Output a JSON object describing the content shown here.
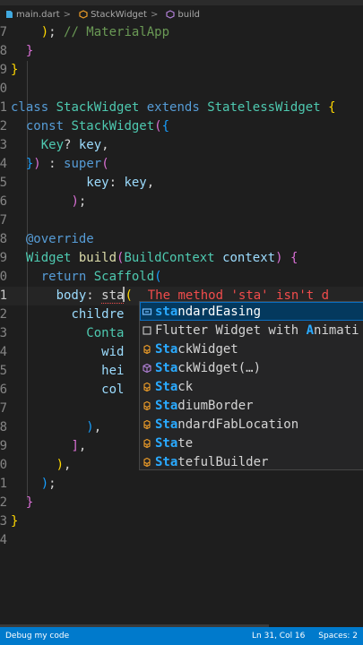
{
  "breadcrumb": {
    "file": "main.dart",
    "class": "StackWidget",
    "method": "build",
    "sep": ">"
  },
  "editor": {
    "lines": [
      {
        "num": "7"
      },
      {
        "num": "8"
      },
      {
        "num": "9"
      },
      {
        "num": "0"
      },
      {
        "num": "1"
      },
      {
        "num": "2"
      },
      {
        "num": "3"
      },
      {
        "num": "4"
      },
      {
        "num": "5"
      },
      {
        "num": "6"
      },
      {
        "num": "7"
      },
      {
        "num": "8"
      },
      {
        "num": "9"
      },
      {
        "num": "0"
      },
      {
        "num": "1"
      },
      {
        "num": "2"
      },
      {
        "num": "3"
      },
      {
        "num": "4"
      },
      {
        "num": "5"
      },
      {
        "num": "6"
      },
      {
        "num": "7"
      },
      {
        "num": "8"
      },
      {
        "num": "9"
      },
      {
        "num": "0"
      },
      {
        "num": "1"
      },
      {
        "num": "2"
      },
      {
        "num": "3"
      },
      {
        "num": "4"
      }
    ],
    "error_message": "The method 'sta' isn't d"
  },
  "suggest": {
    "items": [
      {
        "label_hl": "sta",
        "label_rest": "ndardEasing",
        "icon": "variable-icon"
      },
      {
        "label_pre": "Flutter Widget with ",
        "label_hl2": "A",
        "label_rest": "nimati",
        "icon": "snippet-icon"
      },
      {
        "label_hl": "Sta",
        "label_rest": "ckWidget",
        "icon": "class-icon"
      },
      {
        "label_hl": "Sta",
        "label_rest": "ckWidget(…)",
        "icon": "constructor-icon"
      },
      {
        "label_hl": "Sta",
        "label_rest": "ck",
        "icon": "class-icon"
      },
      {
        "label_hl": "Sta",
        "label_rest": "diumBorder",
        "icon": "class-icon"
      },
      {
        "label_hl": "Sta",
        "label_rest": "ndardFabLocation",
        "icon": "class-icon"
      },
      {
        "label_hl": "Sta",
        "label_rest": "te",
        "icon": "class-icon"
      },
      {
        "label_hl": "Sta",
        "label_rest": "tefulBuilder",
        "icon": "class-icon"
      }
    ]
  },
  "statusbar": {
    "left": "Debug my code",
    "position": "Ln 31, Col 16",
    "spaces": "Spaces: 2"
  },
  "colors": {
    "accent": "#007acc",
    "error": "#f14c4c",
    "match": "#2aaaff"
  }
}
